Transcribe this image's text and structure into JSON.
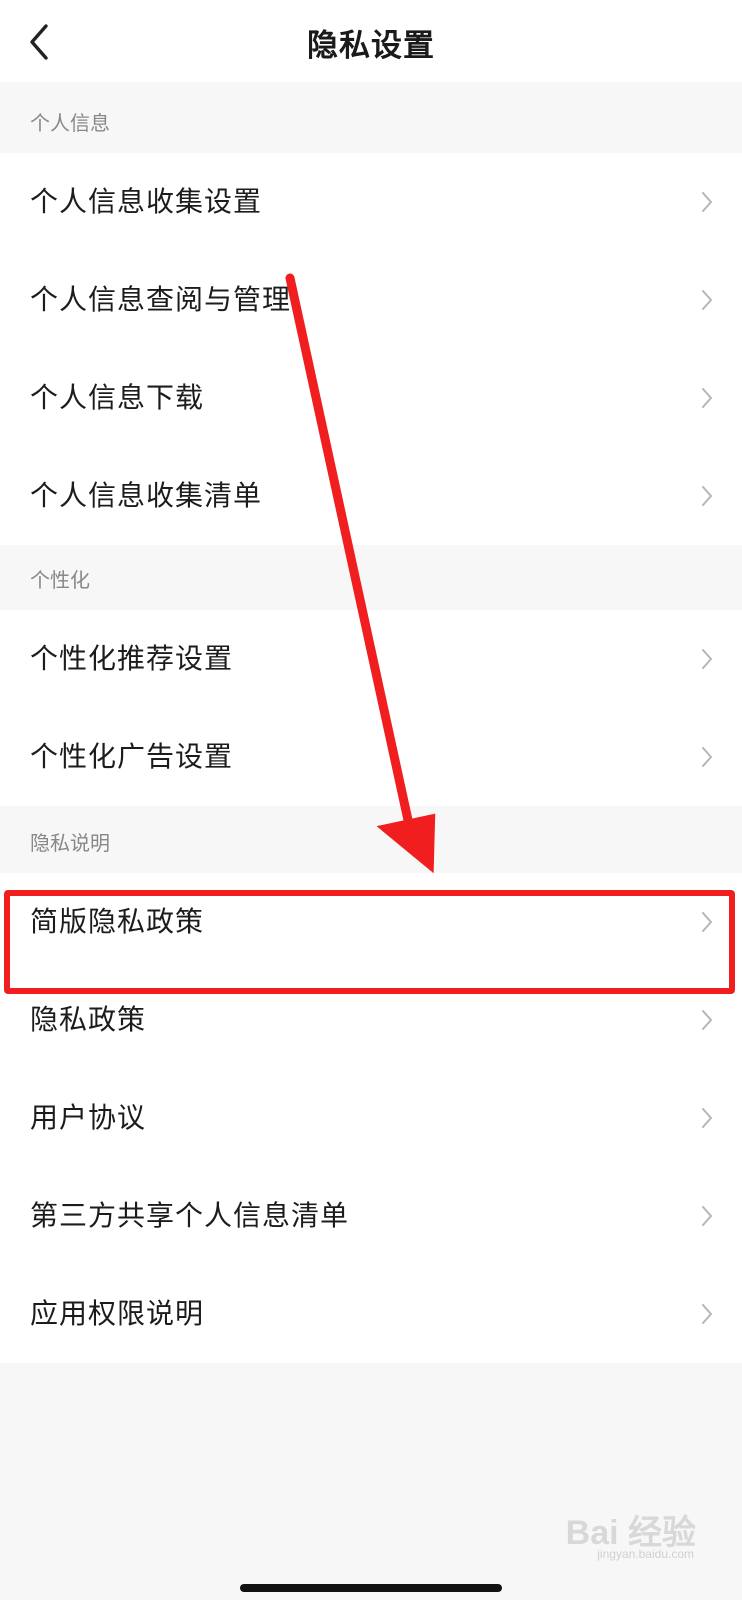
{
  "header": {
    "title": "隐私设置",
    "back_icon": "chevron-left-icon"
  },
  "sections": [
    {
      "title": "个人信息",
      "items": [
        {
          "label": "个人信息收集设置"
        },
        {
          "label": "个人信息查阅与管理"
        },
        {
          "label": "个人信息下载"
        },
        {
          "label": "个人信息收集清单"
        }
      ]
    },
    {
      "title": "个性化",
      "items": [
        {
          "label": "个性化推荐设置"
        },
        {
          "label": "个性化广告设置"
        }
      ]
    },
    {
      "title": "隐私说明",
      "items": [
        {
          "label": "简版隐私政策"
        },
        {
          "label": "隐私政策"
        },
        {
          "label": "用户协议"
        },
        {
          "label": "第三方共享个人信息清单"
        },
        {
          "label": "应用权限说明"
        }
      ]
    }
  ],
  "annotation": {
    "color": "#f01e1e",
    "highlighted_item": "简版隐私政策"
  },
  "watermark": {
    "text": "Bai 经验",
    "sub": "jingyan.baidu.com"
  }
}
